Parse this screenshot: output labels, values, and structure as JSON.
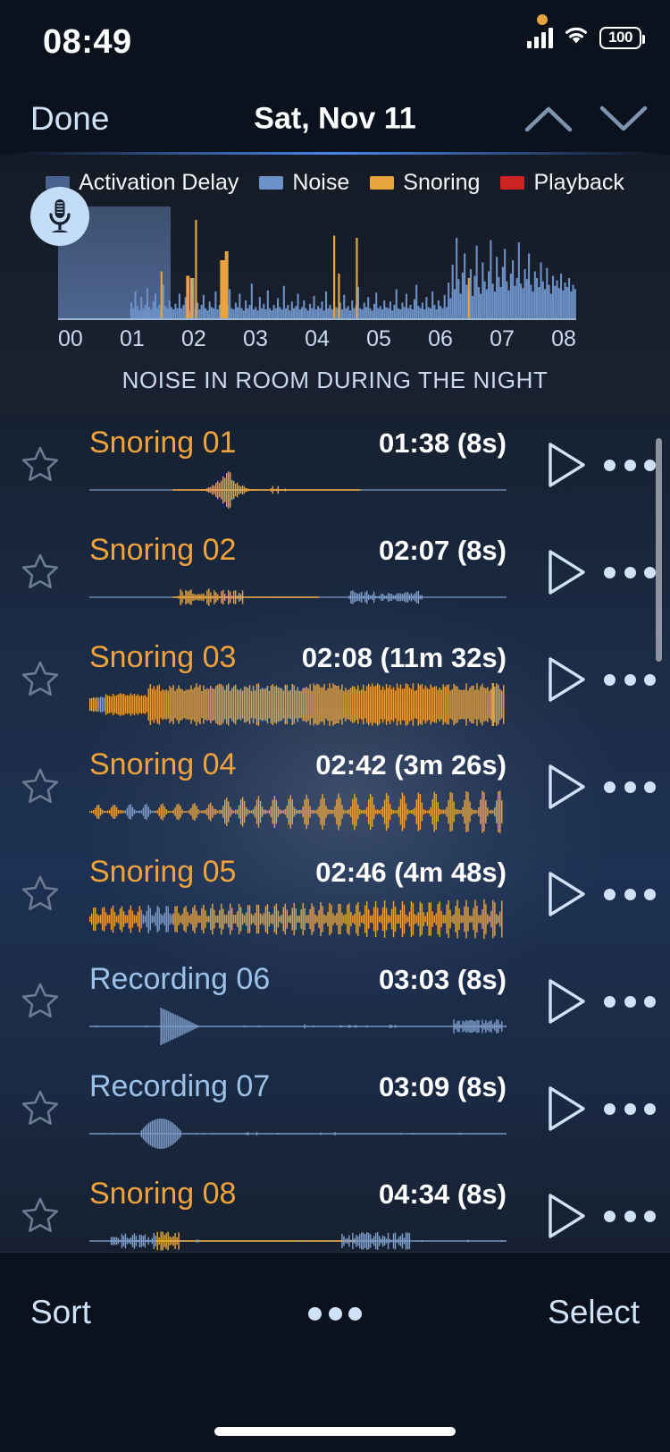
{
  "status_bar": {
    "time": "08:49",
    "battery_level": "100",
    "icons": [
      "orange-recording-dot",
      "cellular-signal-icon",
      "wifi-icon",
      "battery-icon"
    ]
  },
  "nav_bar": {
    "done_label": "Done",
    "title": "Sat, Nov 11",
    "prev_icon": "chevron-up-icon",
    "next_icon": "chevron-down-icon"
  },
  "chart_data": {
    "type": "bar",
    "title": "NOISE IN ROOM DURING THE NIGHT",
    "xlabel": "",
    "ylabel": "",
    "grid": false,
    "legend_position": "top",
    "categories": [
      "00",
      "01",
      "02",
      "03",
      "04",
      "05",
      "06",
      "07",
      "08"
    ],
    "xlim": [
      0,
      8.7
    ],
    "ylim": [
      0,
      100
    ],
    "legend": [
      {
        "label": "Activation Delay",
        "color": "#4a6punkt"
      },
      {
        "label": "Noise",
        "color": "#6d92c7"
      },
      {
        "label": "Snoring",
        "color": "#e8a33d"
      },
      {
        "label": "Playback",
        "color": "#cc2222"
      }
    ],
    "annotations": [
      {
        "name": "activation-delay-region",
        "from": "00:00",
        "to": "01:36",
        "icon": "microphone-icon"
      }
    ],
    "series": [
      {
        "name": "Noise",
        "color": "#6d92c7",
        "values": [
          0,
          0,
          0,
          0,
          0,
          0,
          0,
          0,
          0,
          0,
          0,
          0,
          0,
          0,
          0,
          0,
          0,
          0,
          0,
          0,
          0,
          0,
          0,
          0,
          0,
          0,
          0,
          0,
          0,
          0,
          0,
          0,
          0,
          0,
          0,
          0,
          14,
          9,
          24,
          11,
          7,
          19,
          9,
          12,
          27,
          10,
          8,
          15,
          22,
          9,
          12,
          7,
          30,
          11,
          9,
          16,
          10,
          8,
          13,
          9,
          22,
          9,
          12,
          19,
          9,
          6,
          11,
          36,
          9,
          14,
          8,
          12,
          21,
          9,
          7,
          15,
          10,
          9,
          24,
          8,
          12,
          9,
          18,
          7,
          11,
          26,
          9,
          8,
          14,
          10,
          22,
          9,
          7,
          16,
          9,
          12,
          31,
          8,
          10,
          7,
          19,
          9,
          13,
          8,
          25,
          9,
          7,
          12,
          9,
          18,
          10,
          8,
          29,
          9,
          12,
          7,
          15,
          9,
          11,
          22,
          8,
          10,
          16,
          9,
          7,
          13,
          9,
          20,
          8,
          11,
          9,
          15,
          7,
          24,
          9,
          12,
          8,
          17,
          10,
          9,
          14,
          8,
          21,
          9,
          11,
          7,
          16,
          9,
          12,
          28,
          9,
          8,
          14,
          10,
          19,
          9,
          7,
          13,
          23,
          9,
          11,
          8,
          16,
          10,
          9,
          15,
          7,
          12,
          26,
          9,
          8,
          14,
          10,
          22,
          9,
          12,
          8,
          17,
          30,
          11,
          9,
          14,
          8,
          19,
          10,
          9,
          24,
          12,
          8,
          16,
          11,
          9,
          21,
          10,
          32,
          18,
          48,
          26,
          72,
          35,
          22,
          41,
          58,
          30,
          25,
          44,
          20,
          38,
          65,
          28,
          22,
          50,
          33,
          26,
          42,
          70,
          31,
          24,
          55,
          37,
          28,
          46,
          62,
          33,
          25,
          40,
          52,
          29,
          36,
          68,
          31,
          27,
          44,
          35,
          58,
          30,
          24,
          42,
          36,
          28,
          50,
          33,
          26,
          45,
          30,
          22,
          38,
          29,
          34,
          27,
          40,
          25,
          32,
          28,
          36,
          24,
          30,
          26
        ]
      },
      {
        "name": "Snoring",
        "color": "#e8a33d",
        "spikes": [
          {
            "x": 1.72,
            "height": 42
          },
          {
            "x": 2.15,
            "height": 38,
            "width": 0.06
          },
          {
            "x": 2.22,
            "height": 36,
            "width": 0.05
          },
          {
            "x": 2.3,
            "height": 88
          },
          {
            "x": 2.72,
            "height": 52,
            "width": 0.09
          },
          {
            "x": 2.8,
            "height": 60,
            "width": 0.06
          },
          {
            "x": 4.62,
            "height": 74
          },
          {
            "x": 4.7,
            "height": 40
          },
          {
            "x": 5.0,
            "height": 72
          },
          {
            "x": 6.88,
            "height": 36
          }
        ]
      }
    ]
  },
  "recordings": [
    {
      "title": "Snoring 01",
      "kind": "snoring",
      "time": "01:38",
      "duration": "(8s)",
      "favorite": false,
      "wave": "sparse-center-burst"
    },
    {
      "title": "Snoring 02",
      "kind": "snoring",
      "time": "02:07",
      "duration": "(8s)",
      "favorite": false,
      "wave": "left-burst-right-tail"
    },
    {
      "title": "Snoring 03",
      "kind": "snoring",
      "time": "02:08",
      "duration": "(11m 32s)",
      "favorite": false,
      "wave": "dense-full"
    },
    {
      "title": "Snoring 04",
      "kind": "snoring",
      "time": "02:42",
      "duration": "(3m 26s)",
      "favorite": false,
      "wave": "periodic-spikes"
    },
    {
      "title": "Snoring 05",
      "kind": "snoring",
      "time": "02:46",
      "duration": "(4m 48s)",
      "favorite": false,
      "wave": "periodic-dense"
    },
    {
      "title": "Recording 06",
      "kind": "recording",
      "time": "03:03",
      "duration": "(8s)",
      "favorite": false,
      "wave": "single-peak-tail"
    },
    {
      "title": "Recording 07",
      "kind": "recording",
      "time": "03:09",
      "duration": "(8s)",
      "favorite": false,
      "wave": "single-blob"
    },
    {
      "title": "Snoring 08",
      "kind": "snoring",
      "time": "04:34",
      "duration": "(8s)",
      "favorite": false,
      "wave": "two-bursts"
    }
  ],
  "row_icons": {
    "favorite": "star-outline-icon",
    "play": "play-triangle-icon",
    "more": "ellipsis-icon"
  },
  "bottom_bar": {
    "sort_label": "Sort",
    "more_icon": "ellipsis-icon",
    "select_label": "Select"
  },
  "colors": {
    "accent_blue": "#4a86e8",
    "snoring_orange": "#f0a23c",
    "noise_blue": "#6d92c7",
    "playback_red": "#cc2222",
    "activation_delay": "#4b628c",
    "link_blue": "#cfe2f7"
  }
}
